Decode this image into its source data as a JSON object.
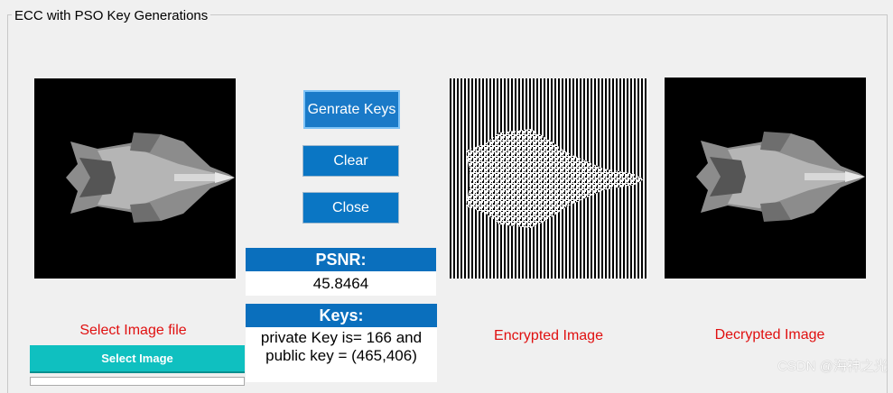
{
  "window": {
    "group_title": "ECC with PSO Key Generations"
  },
  "buttons": {
    "generate": "Genrate Keys",
    "clear": "Clear",
    "close": "Close",
    "select_image": "Select Image"
  },
  "labels": {
    "select_image_file": "Select Image file",
    "encrypted_image": "Encrypted Image",
    "decrypted_image": "Decrypted Image"
  },
  "psnr": {
    "title": "PSNR:",
    "value": "45.8464"
  },
  "keys": {
    "title": "Keys:",
    "line1": "private Key is= 166 and",
    "line2": "public key = (465,406)"
  },
  "watermark": "CSDN @海神之光",
  "colors": {
    "button_blue": "#0a76c4",
    "panel_blue": "#0a6fbd",
    "teal": "#0fc0c0",
    "label_red": "#e01010"
  },
  "icons": [
    "jet-image",
    "encrypted-noise-image",
    "jet-image"
  ]
}
